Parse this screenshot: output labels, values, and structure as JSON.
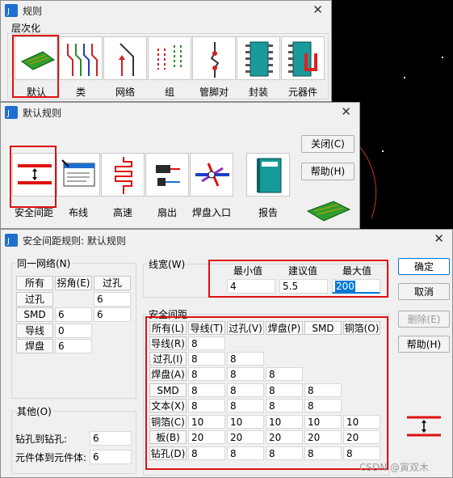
{
  "rules_window": {
    "title": "规则",
    "section": "层次化",
    "tiles": [
      "默认",
      "类",
      "网络",
      "组",
      "管脚对",
      "封装",
      "元器件"
    ]
  },
  "default_rules_window": {
    "title": "默认规则",
    "tiles": [
      "安全间距",
      "布线",
      "高速",
      "扇出",
      "焊盘入口",
      "报告"
    ],
    "close_button": "关闭(C)",
    "help_button": "帮助(H)"
  },
  "clearance_dialog": {
    "title": "安全间距规则: 默认规则",
    "same_net": {
      "label": "同一网络(N)",
      "header": [
        "所有",
        "拐角(E)",
        "过孔"
      ],
      "header_row_value": "6",
      "rows": [
        {
          "label": "过孔",
          "values": [
            "6"
          ]
        },
        {
          "label": "SMD",
          "values": [
            "6",
            "6"
          ]
        },
        {
          "label": "导线",
          "values": [
            "0"
          ]
        },
        {
          "label": "焊盘",
          "values": [
            "6"
          ]
        }
      ]
    },
    "other": {
      "label": "其他(O)",
      "drill_to_drill_label": "钻孔到钻孔:",
      "drill_to_drill_value": "6",
      "body_to_body_label": "元件体到元件体:",
      "body_to_body_value": "6"
    },
    "trace_width": {
      "label": "线宽(W)",
      "min_label": "最小值",
      "min_value": "4",
      "recommended_label": "建议值",
      "recommended_value": "5.5",
      "max_label": "最大值",
      "max_value": "200"
    },
    "clearance": {
      "label": "安全间距",
      "all_button": "所有(L)",
      "columns": [
        "导线(T)",
        "过孔(V)",
        "焊盘(P)",
        "SMD",
        "铜箔(O)"
      ],
      "rows": [
        {
          "label": "导线(R)",
          "values": [
            "8"
          ]
        },
        {
          "label": "过孔(I)",
          "values": [
            "8",
            "8"
          ]
        },
        {
          "label": "焊盘(A)",
          "values": [
            "8",
            "8",
            "8"
          ]
        },
        {
          "label": "SMD",
          "values": [
            "8",
            "8",
            "8",
            "8"
          ]
        },
        {
          "label": "文本(X)",
          "values": [
            "8",
            "8",
            "8",
            "8"
          ]
        },
        {
          "label": "铜箔(C)",
          "values": [
            "10",
            "10",
            "10",
            "10",
            "10"
          ]
        },
        {
          "label": "板(B)",
          "values": [
            "20",
            "20",
            "20",
            "20",
            "20"
          ]
        },
        {
          "label": "钻孔(D)",
          "values": [
            "8",
            "8",
            "8",
            "8",
            "8"
          ]
        }
      ]
    },
    "buttons": {
      "ok": "确定",
      "cancel": "取消",
      "delete": "删除(E)",
      "help": "帮助(H)"
    }
  },
  "watermark": "CSDN @寅双木",
  "colors": {
    "highlight_red": "#e01010",
    "selection_blue": "#0078d7",
    "pcb_green": "#2f9e2f"
  }
}
